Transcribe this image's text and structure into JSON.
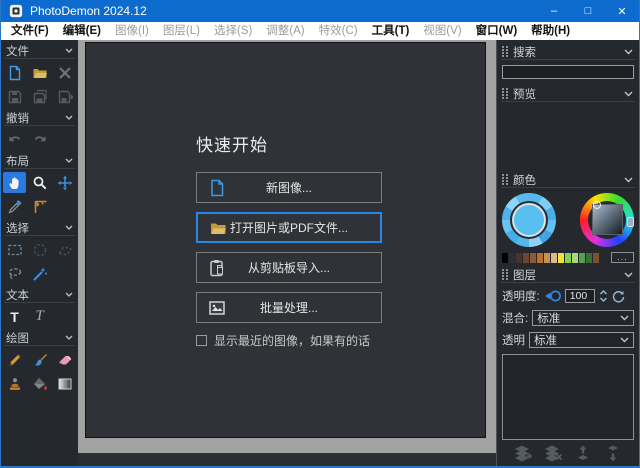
{
  "window": {
    "title": "PhotoDemon 2024.12",
    "controls": {
      "minimize": "–",
      "maximize": "□",
      "close": "✕"
    }
  },
  "menu": {
    "items": [
      {
        "label": "文件(F)",
        "enabled": true
      },
      {
        "label": "编辑(E)",
        "enabled": true
      },
      {
        "label": "图像(I)",
        "enabled": false
      },
      {
        "label": "图层(L)",
        "enabled": false
      },
      {
        "label": "选择(S)",
        "enabled": false
      },
      {
        "label": "调整(A)",
        "enabled": false
      },
      {
        "label": "特效(C)",
        "enabled": false
      },
      {
        "label": "工具(T)",
        "enabled": true
      },
      {
        "label": "视图(V)",
        "enabled": false
      },
      {
        "label": "窗口(W)",
        "enabled": true
      },
      {
        "label": "帮助(H)",
        "enabled": true
      }
    ]
  },
  "toolbox": {
    "sections": [
      {
        "title": "文件",
        "tools": [
          "new-image",
          "open-image",
          "close-image",
          "save",
          "save-as",
          "save-copy"
        ]
      },
      {
        "title": "撤销",
        "tools": [
          "undo",
          "redo"
        ]
      },
      {
        "title": "布局",
        "tools": [
          "hand",
          "zoom",
          "move",
          "color-picker",
          "measure"
        ]
      },
      {
        "title": "选择",
        "tools": [
          "rect-select",
          "ellipse-select",
          "polygon-select",
          "lasso-select",
          "magic-wand"
        ]
      },
      {
        "title": "文本",
        "tools": [
          "basic-text",
          "advanced-text"
        ]
      },
      {
        "title": "绘图",
        "tools": [
          "pencil",
          "paintbrush",
          "eraser",
          "clone-stamp",
          "fill",
          "gradient"
        ]
      }
    ],
    "selected_tool": "hand",
    "text_tool_glyph": "T",
    "advanced_text_tool_glyph": "T"
  },
  "quick_start": {
    "title": "快速开始",
    "buttons": [
      {
        "icon": "new-image-icon",
        "label": "新图像..."
      },
      {
        "icon": "open-file-icon",
        "label": "打开图片或PDF文件...",
        "focused": true
      },
      {
        "icon": "clipboard-icon",
        "label": "从剪贴板导入..."
      },
      {
        "icon": "batch-icon",
        "label": "批量处理..."
      }
    ],
    "recent_checkbox": {
      "label": "显示最近的图像，如果有的话",
      "checked": false
    }
  },
  "right_panel": {
    "search": {
      "title": "搜索",
      "value": ""
    },
    "preview": {
      "title": "预览"
    },
    "color": {
      "title": "颜色",
      "palette": [
        "#000000",
        "#2b2f38",
        "#4a332c",
        "#6b4632",
        "#8a5a3a",
        "#b5722e",
        "#c98f4e",
        "#dbb98b",
        "#efe23c",
        "#7ed44e",
        "#a8d978",
        "#5a9e50",
        "#3c6e3a",
        "#7a5230"
      ],
      "more_label": "..."
    },
    "layers": {
      "title": "图层",
      "opacity": {
        "label": "透明度:",
        "value": "100"
      },
      "blend": {
        "label": "混合:",
        "value": "标准"
      },
      "alpha": {
        "label": "透明",
        "value": "标准"
      }
    }
  },
  "colors": {
    "titlebar": "#0d6bcd",
    "window_border": "#2878c8",
    "selected_tool_bg": "#2a7ae2",
    "focus_border": "#2a86e8",
    "mdi_background": "#a2a2a2",
    "harmony_center": "#58bff0"
  }
}
